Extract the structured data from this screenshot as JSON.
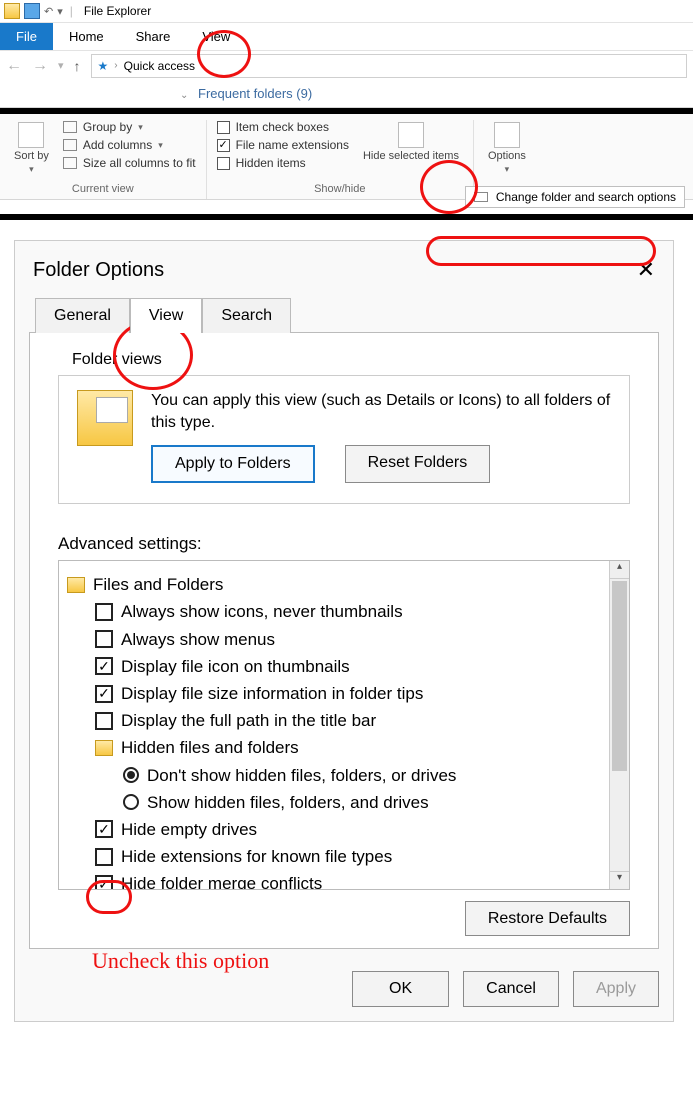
{
  "titlebar": {
    "app_name": "File Explorer"
  },
  "menu": {
    "file": "File",
    "home": "Home",
    "share": "Share",
    "view": "View"
  },
  "address": {
    "quick_access": "Quick access"
  },
  "frequent": {
    "label": "Frequent folders (9)"
  },
  "ribbon": {
    "sort_by": "Sort by",
    "group_by": "Group by",
    "add_columns": "Add columns",
    "size_all": "Size all columns to fit",
    "current_view_label": "Current view",
    "item_check_boxes": "Item check boxes",
    "file_name_ext": "File name extensions",
    "hidden_items": "Hidden items",
    "hide_selected": "Hide selected items",
    "show_hide_label": "Show/hide",
    "options": "Options",
    "change_folder_opts": "Change folder and search options"
  },
  "dialog": {
    "title": "Folder Options",
    "tabs": {
      "general": "General",
      "view": "View",
      "search": "Search"
    },
    "folder_views_legend": "Folder views",
    "folder_views_text": "You can apply this view (such as Details or Icons) to all folders of this type.",
    "apply_to_folders": "Apply to Folders",
    "reset_folders": "Reset Folders",
    "advanced_label": "Advanced settings:",
    "restore_defaults": "Restore Defaults",
    "ok": "OK",
    "cancel": "Cancel",
    "apply": "Apply"
  },
  "adv": {
    "files_and_folders": "Files and Folders",
    "always_icons": "Always show icons, never thumbnails",
    "always_menus": "Always show menus",
    "display_icon_thumb": "Display file icon on thumbnails",
    "display_size_tips": "Display file size information in folder tips",
    "display_full_path": "Display the full path in the title bar",
    "hidden_header": "Hidden files and folders",
    "dont_show_hidden": "Don't show hidden files, folders, or drives",
    "show_hidden": "Show hidden files, folders, and drives",
    "hide_empty": "Hide empty drives",
    "hide_ext": "Hide extensions for known file types",
    "hide_merge": "Hide folder merge conflicts"
  },
  "annotation": {
    "uncheck": "Uncheck this option"
  }
}
